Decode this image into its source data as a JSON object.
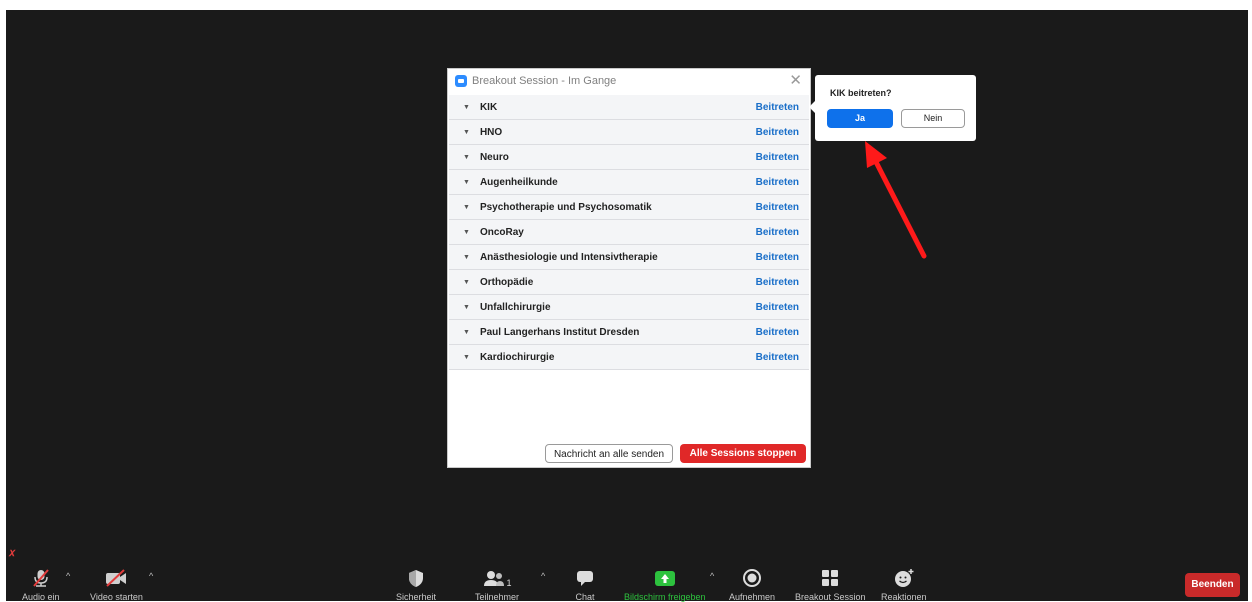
{
  "dialog": {
    "title": "Breakout Session - Im Gange",
    "close_glyph": "✕",
    "join_label": "Beitreten",
    "rooms": [
      {
        "name": "KIK"
      },
      {
        "name": "HNO"
      },
      {
        "name": "Neuro"
      },
      {
        "name": "Augenheilkunde"
      },
      {
        "name": "Psychotherapie und Psychosomatik"
      },
      {
        "name": "OncoRay"
      },
      {
        "name": "Anästhesiologie und Intensivtherapie"
      },
      {
        "name": "Orthopädie"
      },
      {
        "name": "Unfallchirurgie"
      },
      {
        "name": "Paul Langerhans Institut Dresden"
      },
      {
        "name": "Kardiochirurgie"
      }
    ],
    "broadcast_label": "Nachricht an alle senden",
    "stop_all_label": "Alle Sessions stoppen"
  },
  "confirm": {
    "question": "KIK beitreten?",
    "yes_label": "Ja",
    "no_label": "Nein"
  },
  "toolbar": {
    "audio_label": "Audio ein",
    "video_label": "Video starten",
    "security_label": "Sicherheit",
    "participants_label": "Teilnehmer",
    "participants_count": "1",
    "chat_label": "Chat",
    "share_label": "Bildschirm freigeben",
    "record_label": "Aufnehmen",
    "breakout_label": "Breakout Session",
    "reactions_label": "Reaktionen",
    "end_label": "Beenden",
    "caret_glyph": "^"
  },
  "colors": {
    "share_green": "#2dc23e",
    "join_blue": "#1a6fc9",
    "stop_red": "#e02828",
    "arrow_red": "#ff1a1a",
    "end_red": "#c92a2a"
  }
}
